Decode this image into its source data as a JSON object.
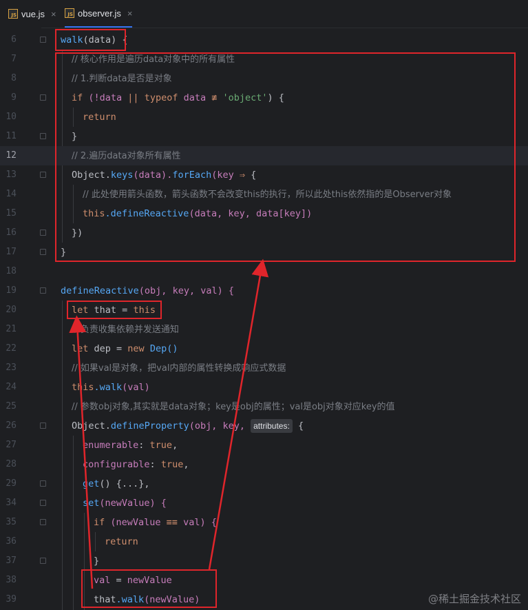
{
  "tabs": [
    {
      "label": "vue.js",
      "icon": "js-file-icon",
      "close": "×"
    },
    {
      "label": "observer.js",
      "icon": "js-file-icon",
      "close": "×"
    }
  ],
  "icon_badge": "JS",
  "line_numbers": [
    "6",
    "7",
    "8",
    "9",
    "10",
    "11",
    "12",
    "13",
    "14",
    "15",
    "16",
    "17",
    "18",
    "19",
    "20",
    "21",
    "22",
    "23",
    "24",
    "25",
    "26",
    "27",
    "28",
    "29",
    "34",
    "35",
    "36",
    "37",
    "38",
    "39"
  ],
  "code": {
    "walk_name": "walk",
    "walk_params": "(data) {",
    "c1": "// 核心作用是遍历data对象中的所有属性",
    "c2": "// 1.判断data是否是对象",
    "if1_kw": "if",
    "if1_a": " (!data ",
    "if1_or": "||",
    "if1_typeof": " typeof",
    "if1_b": " data ",
    "if1_neq": "≢",
    "if1_str": " 'object'",
    "if1_c": ") {",
    "ret1": "return",
    "close1": "}",
    "c3": "// 2.遍历data对象所有属性",
    "obj_keys_a": "Object.",
    "obj_keys_fn": "keys",
    "obj_keys_b": "(data).",
    "foreach_fn": "forEach",
    "foreach_b": "(key ",
    "arrow_op": "⇒",
    "foreach_c": " {",
    "c4": "// 此处使用箭头函数，箭头函数不会改变this的执行，所以此处this依然指的是Observer对象",
    "this_kw": "this",
    "def_call_fn": ".defineReactive",
    "def_call_args": "(data, key, data[key])",
    "close2": "})",
    "close3": "}",
    "def_name": "defineReactive",
    "def_params": "(obj, key, val) {",
    "let_kw": "let",
    "that_var": " that ",
    "eq": "=",
    "this2": " this",
    "c5": "// 负责收集依赖并发送通知",
    "let2_kw": "let",
    "dep_var": " dep ",
    "eq2": "=",
    "new_kw": " new",
    "dep_call": " Dep()",
    "c6": "// 如果val是对象，把val内部的属性转换成响应式数据",
    "this3": "this",
    "walk_call_fn": ".walk",
    "walk_call_args": "(val)",
    "c7": "// 参数obj对象,其实就是data对象；key是obj的属性；val是obj对象对应key的值",
    "odp_a": "Object.",
    "odp_fn": "defineProperty",
    "odp_b": "(obj, key, ",
    "odp_hint": "attributes:",
    "odp_c": " {",
    "enum_prop": "enumerable",
    "colon": ": ",
    "true1": "true",
    "comma": ",",
    "conf_prop": "configurable",
    "true2": "true",
    "get_fn": "get",
    "get_rest": "() {...},",
    "set_fn": "set",
    "set_params": "(newValue) {",
    "if2_kw": "if",
    "if2_a": " (newValue ",
    "if2_eq": "≡≡",
    "if2_b": " val) {",
    "ret2": "return",
    "close4": "}",
    "val_assign": "val ",
    "eq3": "=",
    "new_value": " newValue",
    "that2": "that",
    "walk2_fn": ".walk",
    "walk2_args": "(newValue)"
  },
  "watermark": "@稀土掘金技术社区",
  "colors": {
    "background": "#1e1f22",
    "keyword": "#cf8e6d",
    "function": "#56a8f5",
    "string": "#6aab73",
    "comment": "#7a7e85",
    "annotation_red": "#e0252b"
  }
}
